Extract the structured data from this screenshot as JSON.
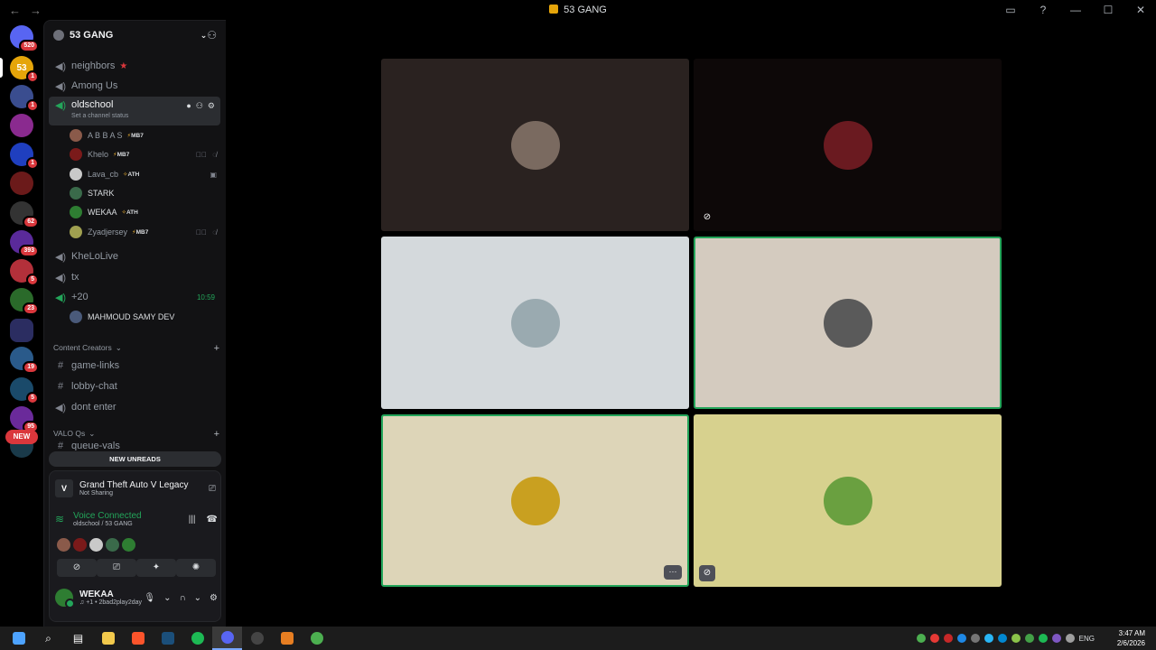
{
  "window": {
    "title": "53 GANG"
  },
  "servers": [
    {
      "name": "discord-home",
      "badge": "520",
      "color": "#5865f2"
    },
    {
      "name": "53-gang",
      "badge": "1",
      "color": "#e5a50a",
      "text": "53"
    },
    {
      "name": "server-3",
      "badge": "1",
      "color": "#3a4d8f"
    },
    {
      "name": "server-4",
      "badge": "",
      "color": "#8a2a8f"
    },
    {
      "name": "server-5",
      "badge": "1",
      "color": "#1f3fbf"
    },
    {
      "name": "server-6",
      "badge": "",
      "color": "#6b1a1a"
    },
    {
      "name": "server-7",
      "badge": "62",
      "color": "#333333"
    },
    {
      "name": "server-8",
      "badge": "393",
      "color": "#5a2a9a"
    },
    {
      "name": "server-9",
      "badge": "5",
      "color": "#b3303a"
    },
    {
      "name": "server-10",
      "badge": "23",
      "color": "#2a6a2a"
    },
    {
      "name": "folder",
      "badge": "",
      "color": "#2b2d61"
    },
    {
      "name": "server-12",
      "badge": "19",
      "color": "#2a5a8a"
    },
    {
      "name": "server-13",
      "badge": "5",
      "color": "#1a4a6a"
    },
    {
      "name": "server-14",
      "badge": "95",
      "color": "#6a2a9a"
    },
    {
      "name": "server-15",
      "badge": "",
      "color": "#1a3a4a"
    }
  ],
  "rail_new": "NEW",
  "guild": {
    "name": "53 GANG"
  },
  "channels": {
    "neighbors": "neighbors",
    "among_us": "Among Us",
    "oldschool": "oldschool",
    "oldschool_status": "Set a channel status",
    "khelolive": "KheLoLive",
    "tx": "tx",
    "plus20": "+20",
    "plus20_time": "10:59",
    "game_links": "game-links",
    "lobby_chat": "lobby-chat",
    "dont_enter": "dont enter",
    "queue_vals": "queue-vals"
  },
  "categories": {
    "content_creators": "Content Creators",
    "valo_qs": "VALO Qs"
  },
  "voice_users": [
    {
      "name": "A B B A S",
      "tag": "MB7",
      "tag_icon": "lightning",
      "color": "#8a5a4a",
      "icons": ""
    },
    {
      "name": "Khelo",
      "tag": "MB7",
      "tag_icon": "lightning",
      "color": "#7a1a1a",
      "icons": "✎⃠ ◌̸"
    },
    {
      "name": "Lava_cb",
      "tag": "ATH",
      "tag_icon": "diamond",
      "color": "#c9c9c9",
      "icons": "▣"
    },
    {
      "name": "STARK",
      "tag": "",
      "tag_icon": "",
      "color": "#3a6a4a",
      "icons": ""
    },
    {
      "name": "WEKAA",
      "tag": "ATH",
      "tag_icon": "diamond",
      "color": "#2e7d32",
      "icons": ""
    },
    {
      "name": "Zyadjersey",
      "tag": "MB7",
      "tag_icon": "lightning",
      "color": "#a0a050",
      "icons": "✎⃠ ◌̸"
    }
  ],
  "plus20_user": {
    "name": "MAHMOUD SAMY DEV",
    "color": "#4a5a7a"
  },
  "new_unreads": "NEW UNREADS",
  "activity": {
    "game": "Grand Theft Auto V Legacy",
    "status": "Not Sharing"
  },
  "voice": {
    "status": "Voice Connected",
    "location": "oldschool / 53 GANG"
  },
  "account": {
    "name": "WEKAA",
    "status": "♫ +1 • 2bad2play2day"
  },
  "tiles": [
    {
      "bg": "#2a2220",
      "avatar": "#7a6a60",
      "speaking": false,
      "muted": false
    },
    {
      "bg": "#0d0808",
      "avatar": "#6a1a20",
      "speaking": false,
      "muted": true
    },
    {
      "bg": "#d4d9dc",
      "avatar": "#9aaab0",
      "speaking": false,
      "muted": false
    },
    {
      "bg": "#d4cbbf",
      "avatar": "#5a5a5a",
      "speaking": true,
      "muted": false
    },
    {
      "bg": "#ddd5b8",
      "avatar": "#c9a020",
      "speaking": true,
      "muted": false,
      "more": "···"
    },
    {
      "bg": "#d7d18e",
      "avatar": "#6aa040",
      "speaking": false,
      "muted": true
    }
  ],
  "taskbar": {
    "lang": "ENG",
    "time": "3:47 AM",
    "date": "2/6/2026"
  }
}
